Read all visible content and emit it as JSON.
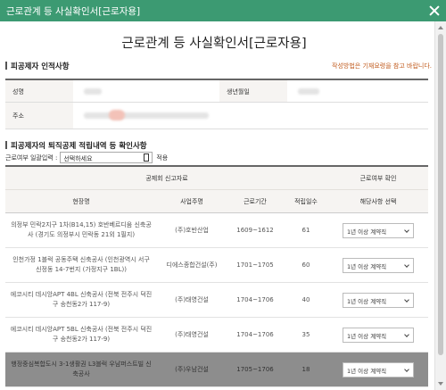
{
  "window": {
    "title": "근로관계 등 사실확인서[근로자용]"
  },
  "document": {
    "title": "근로관계 등 사실확인서[근로자용]"
  },
  "section1": {
    "heading": "피공제자 인적사항",
    "notice": "작성방법은 기재요령을 참고 바랍니다.",
    "name_label": "성명",
    "birth_label": "생년월일",
    "address_label": "주소"
  },
  "section2": {
    "heading": "피공제자의 퇴직공제 적립내역 등 확인사항",
    "filter_label": "근로여부 일괄입력 :",
    "filter_value": "선택하세요",
    "apply_label": "적용"
  },
  "table": {
    "group_left": "공제회 신고자료",
    "group_right": "근로여부 확인",
    "headers": [
      "현장명",
      "사업주명",
      "근로기간",
      "적립일수",
      "해당사항 선택"
    ],
    "rows": [
      {
        "site": "의정부 민락2지구 1차(B14,15) 호반베르디움 신축공사 (경기도 의정부시 민락동 21외 1필지)",
        "employer": "(주)호반산업",
        "period": "1609~1612",
        "days": "61",
        "select": "1년 이상 계약직"
      },
      {
        "site": "인천가정 1블럭 공동주택 신축공사 (인천광역시 서구 신정동 14-7번지 (가정지구 1BL))",
        "employer": "디에스종합건설(주)",
        "period": "1701~1705",
        "days": "60",
        "select": "1년 이상 계약직"
      },
      {
        "site": "에코시티 데시앙APT 4BL 신축공사 (전북 전주시 덕진구 송천동2가 117-9)",
        "employer": "(주)태영건설",
        "period": "1704~1706",
        "days": "40",
        "select": "1년 이상 계약직"
      },
      {
        "site": "에코시티 데시앙APT 5BL 신축공사 (전북 전주시 덕진구 송천동2가 117-9)",
        "employer": "(주)태영건설",
        "period": "1704~1706",
        "days": "35",
        "select": "1년 이상 계약직"
      },
      {
        "site": "행정중심복합도시 3-1생활권 L3블럭 우남퍼스트빌 신축공사",
        "employer": "(주)우남건설",
        "period": "1705~1706",
        "days": "18",
        "select": "1년 이상 계약직"
      }
    ]
  }
}
